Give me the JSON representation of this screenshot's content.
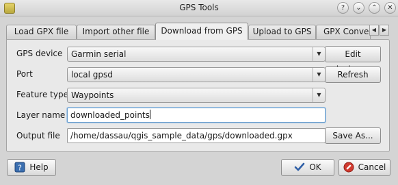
{
  "window": {
    "title": "GPS Tools"
  },
  "titlebar_buttons": {
    "help": "?",
    "minimize": "⌄",
    "maximize": "⌃",
    "close": "✕"
  },
  "tabs": [
    {
      "label": "Load GPX file",
      "active": false
    },
    {
      "label": "Import other file",
      "active": false
    },
    {
      "label": "Download from GPS",
      "active": true
    },
    {
      "label": "Upload to GPS",
      "active": false
    },
    {
      "label": "GPX Convers",
      "active": false
    }
  ],
  "tab_scroll": {
    "left": "◀",
    "right": "▶"
  },
  "form": {
    "gps_device": {
      "label": "GPS device",
      "value": "Garmin serial"
    },
    "port": {
      "label": "Port",
      "value": "local gpsd"
    },
    "feature_type": {
      "label": "Feature type",
      "value": "Waypoints"
    },
    "layer_name": {
      "label": "Layer name",
      "value": "downloaded_points"
    },
    "output_file": {
      "label": "Output file",
      "value": "/home/dassau/qgis_sample_data/gps/downloaded.gpx"
    }
  },
  "buttons": {
    "edit_devices": "Edit devices...",
    "refresh": "Refresh",
    "save_as": "Save As...",
    "help": "Help",
    "ok": "OK",
    "cancel": "Cancel"
  },
  "combo_arrow": "▼"
}
